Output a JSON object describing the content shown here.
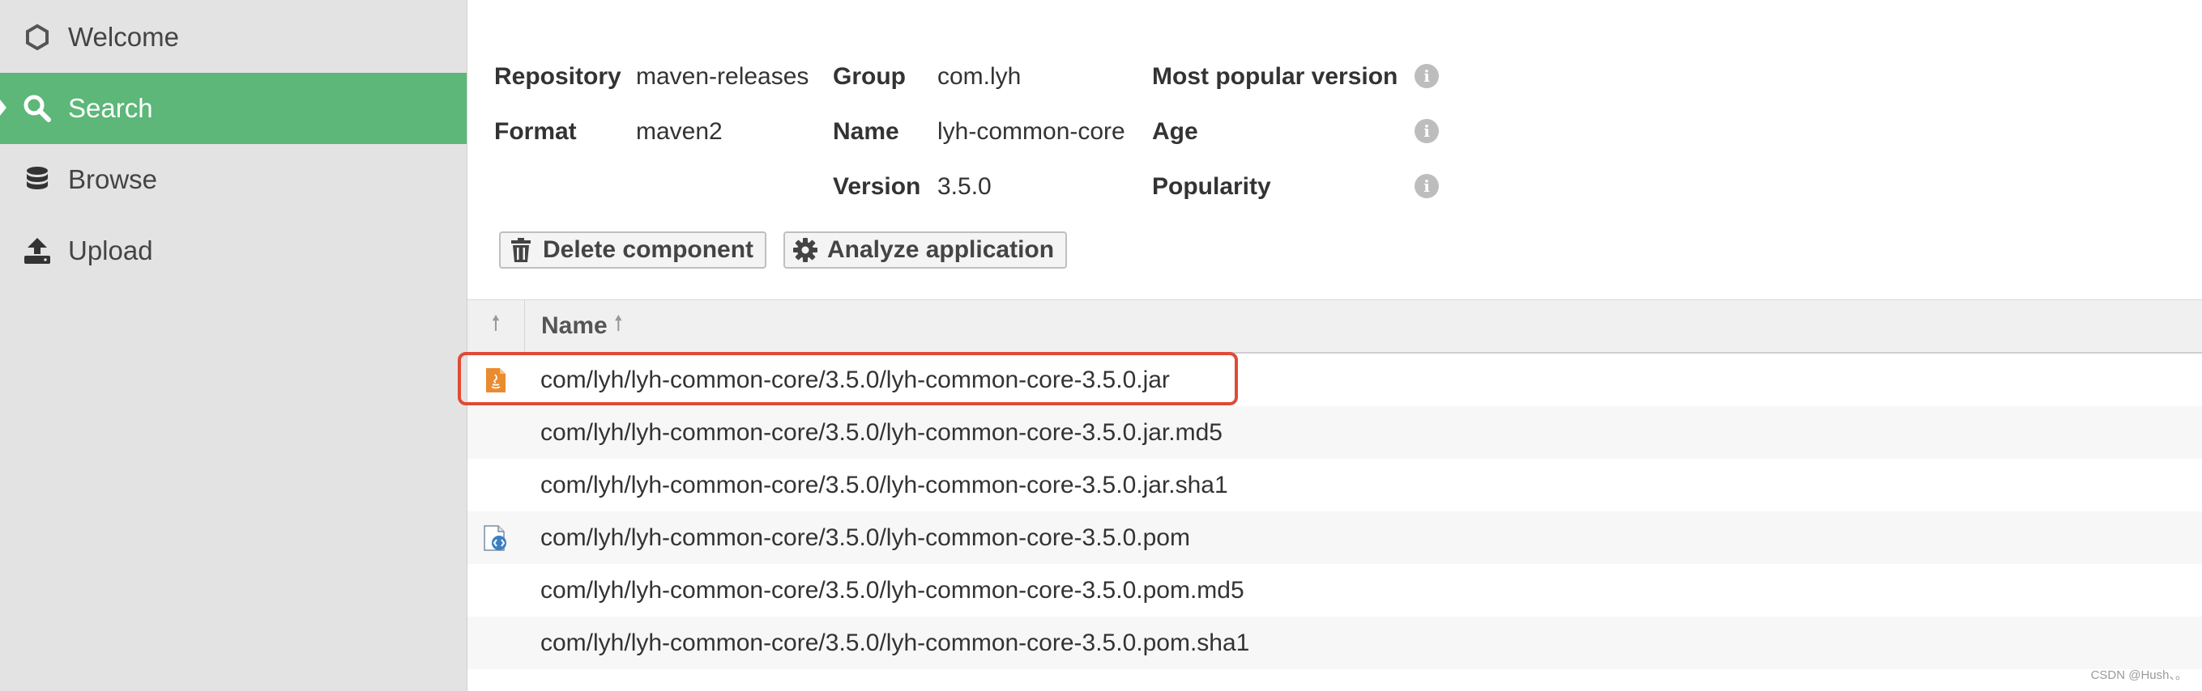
{
  "sidebar": {
    "items": [
      {
        "label": "Welcome",
        "icon": "hexagon-icon"
      },
      {
        "label": "Search",
        "icon": "search-icon",
        "active": true
      },
      {
        "label": "Browse",
        "icon": "database-icon"
      },
      {
        "label": "Upload",
        "icon": "upload-icon"
      }
    ]
  },
  "info": {
    "repository_label": "Repository",
    "repository_value": "maven-releases",
    "format_label": "Format",
    "format_value": "maven2",
    "group_label": "Group",
    "group_value": "com.lyh",
    "name_label": "Name",
    "name_value": "lyh-common-core",
    "version_label": "Version",
    "version_value": "3.5.0",
    "most_popular_label": "Most popular version",
    "age_label": "Age",
    "popularity_label": "Popularity"
  },
  "actions": {
    "delete_label": "Delete component",
    "analyze_label": "Analyze application"
  },
  "table": {
    "name_header": "Name",
    "rows": [
      {
        "name": "com/lyh/lyh-common-core/3.5.0/lyh-common-core-3.5.0.jar",
        "icon": "java-file-icon"
      },
      {
        "name": "com/lyh/lyh-common-core/3.5.0/lyh-common-core-3.5.0.jar.md5",
        "icon": ""
      },
      {
        "name": "com/lyh/lyh-common-core/3.5.0/lyh-common-core-3.5.0.jar.sha1",
        "icon": ""
      },
      {
        "name": "com/lyh/lyh-common-core/3.5.0/lyh-common-core-3.5.0.pom",
        "icon": "xml-file-icon"
      },
      {
        "name": "com/lyh/lyh-common-core/3.5.0/lyh-common-core-3.5.0.pom.md5",
        "icon": ""
      },
      {
        "name": "com/lyh/lyh-common-core/3.5.0/lyh-common-core-3.5.0.pom.sha1",
        "icon": ""
      }
    ]
  },
  "watermark": "CSDN @Hush、。",
  "colors": {
    "accent": "#5cb778",
    "highlight": "#e04a36",
    "sidebar_bg": "#e3e3e3"
  }
}
